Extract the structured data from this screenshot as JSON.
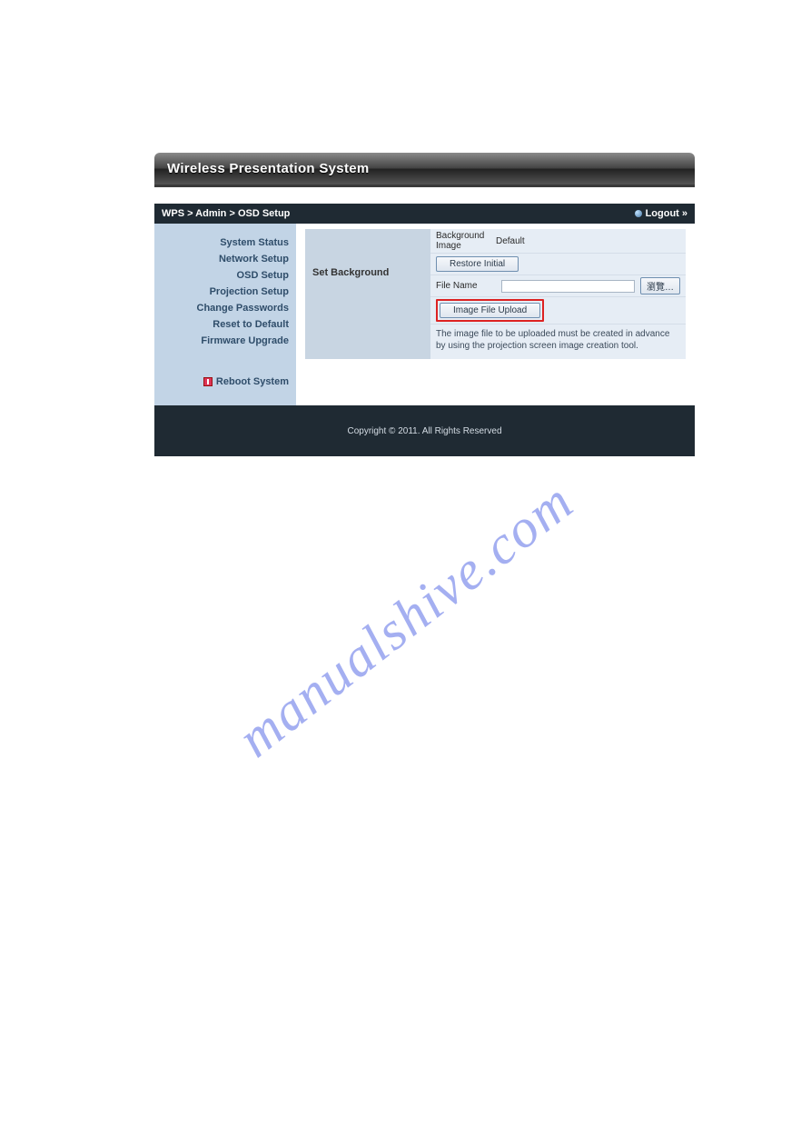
{
  "header": {
    "title": "Wireless Presentation System"
  },
  "breadcrumb": {
    "path": "WPS > Admin > OSD Setup",
    "logout": "Logout »"
  },
  "sidebar": {
    "items": [
      "System Status",
      "Network Setup",
      "OSD Setup",
      "Projection Setup",
      "Change Passwords",
      "Reset to Default",
      "Firmware Upgrade"
    ],
    "reboot": "Reboot System"
  },
  "panel": {
    "heading": "Set Background",
    "bg_image_label": "Background Image",
    "bg_image_value": "Default",
    "restore_button": "Restore Initial",
    "file_name_label": "File Name",
    "browse_button": "瀏覽…",
    "upload_button": "Image File Upload",
    "note": "The image file to be uploaded must be created in advance by using the projection screen image creation tool."
  },
  "footer": {
    "copyright": "Copyright © 2011. All Rights Reserved"
  },
  "watermark": "manualshive.com"
}
